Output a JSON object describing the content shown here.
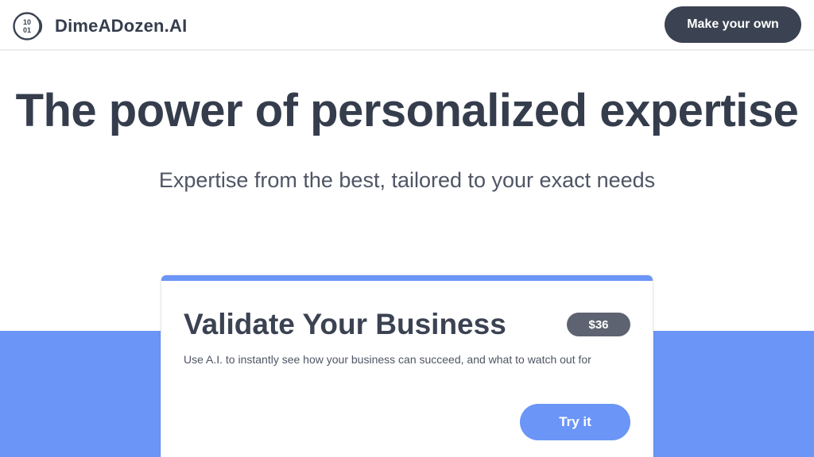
{
  "header": {
    "logo_icon": "coin-binary-icon",
    "logo_glyph_top": "10",
    "logo_glyph_bottom": "01",
    "brand": "DimeADozen.AI",
    "cta_label": "Make your own"
  },
  "hero": {
    "title": "The power of personalized expertise",
    "subtitle": "Expertise from the best, tailored to your exact needs"
  },
  "card": {
    "title": "Validate Your Business",
    "price": "$36",
    "description": "Use A.I. to instantly see how your business can succeed, and what to watch out for",
    "button_label": "Try it"
  },
  "colors": {
    "accent": "#6b95f7",
    "dark": "#3b4252",
    "text": "#353d4d"
  }
}
